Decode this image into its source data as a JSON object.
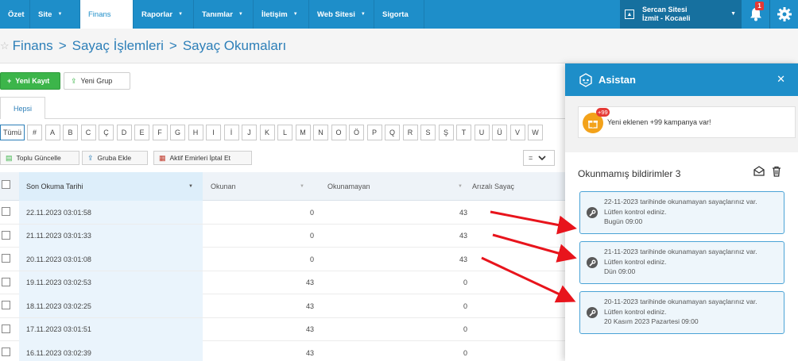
{
  "nav": {
    "items": [
      {
        "label": "Özet",
        "caret": false,
        "active": false,
        "width": 38
      },
      {
        "label": "Site",
        "caret": true,
        "active": false,
        "width": 63
      },
      {
        "label": "Finans",
        "caret": false,
        "active": true,
        "width": 67
      },
      {
        "label": "Raporlar",
        "caret": true,
        "active": false,
        "width": 76
      },
      {
        "label": "Tanımlar",
        "caret": true,
        "active": false,
        "width": 75
      },
      {
        "label": "İletişim",
        "caret": true,
        "active": false,
        "width": 70
      },
      {
        "label": "Web Sitesi",
        "caret": true,
        "active": false,
        "width": 82
      },
      {
        "label": "Sigorta",
        "caret": false,
        "active": false,
        "width": 63
      }
    ],
    "user_name": "Sercan Sitesi",
    "user_location": "İzmit - Kocaeli",
    "bell_badge": "1"
  },
  "breadcrumb": [
    "Finans",
    "Sayaç İşlemleri",
    "Sayaç Okumaları"
  ],
  "toolbar": {
    "new_record": "Yeni Kayıt",
    "new_group": "Yeni Grup",
    "bulk_update": "Toplu Güncelle",
    "add_group": "Gruba Ekle",
    "cancel_orders": "Aktif Emirleri İptal Et",
    "filter_op": "="
  },
  "tabs": {
    "all": "Hepsi"
  },
  "letters": [
    "Tümü",
    "#",
    "A",
    "B",
    "C",
    "Ç",
    "D",
    "E",
    "F",
    "G",
    "H",
    "I",
    "İ",
    "J",
    "K",
    "L",
    "M",
    "N",
    "O",
    "Ö",
    "P",
    "Q",
    "R",
    "S",
    "Ş",
    "T",
    "U",
    "Ü",
    "V",
    "W"
  ],
  "table": {
    "columns": [
      "Son Okuma Tarihi",
      "Okunan",
      "Okunamayan",
      "Arızalı Sayaç"
    ],
    "rows": [
      {
        "date": "22.11.2023 03:01:58",
        "read": "0",
        "unread": "43"
      },
      {
        "date": "21.11.2023 03:01:33",
        "read": "0",
        "unread": "43"
      },
      {
        "date": "20.11.2023 03:01:08",
        "read": "0",
        "unread": "43"
      },
      {
        "date": "19.11.2023 03:02:53",
        "read": "43",
        "unread": "0"
      },
      {
        "date": "18.11.2023 03:02:25",
        "read": "43",
        "unread": "0"
      },
      {
        "date": "17.11.2023 03:01:51",
        "read": "43",
        "unread": "0"
      },
      {
        "date": "16.11.2023 03:02:39",
        "read": "43",
        "unread": "0"
      }
    ]
  },
  "assistant": {
    "title": "Asistan",
    "promo_badge": "+99",
    "promo_text": "Yeni eklenen +99 kampanya var!",
    "unread_title": "Okunmamış bildirimler 3",
    "notifications": [
      {
        "line1": "22-11-2023 tarihinde okunamayan sayaçlarınız var.",
        "line2": "Lütfen kontrol ediniz.",
        "time": "Bugün 09:00"
      },
      {
        "line1": "21-11-2023 tarihinde okunamayan sayaçlarınız var.",
        "line2": "Lütfen kontrol ediniz.",
        "time": "Dün 09:00"
      },
      {
        "line1": "20-11-2023 tarihinde okunamayan sayaçlarınız var.",
        "line2": "Lütfen kontrol ediniz.",
        "time": "20 Kasım 2023 Pazartesi 09:00"
      }
    ]
  },
  "colors": {
    "primary": "#1e8ec9",
    "green": "#3cb54a",
    "arrow": "#e8141c",
    "badge": "#e53935"
  }
}
